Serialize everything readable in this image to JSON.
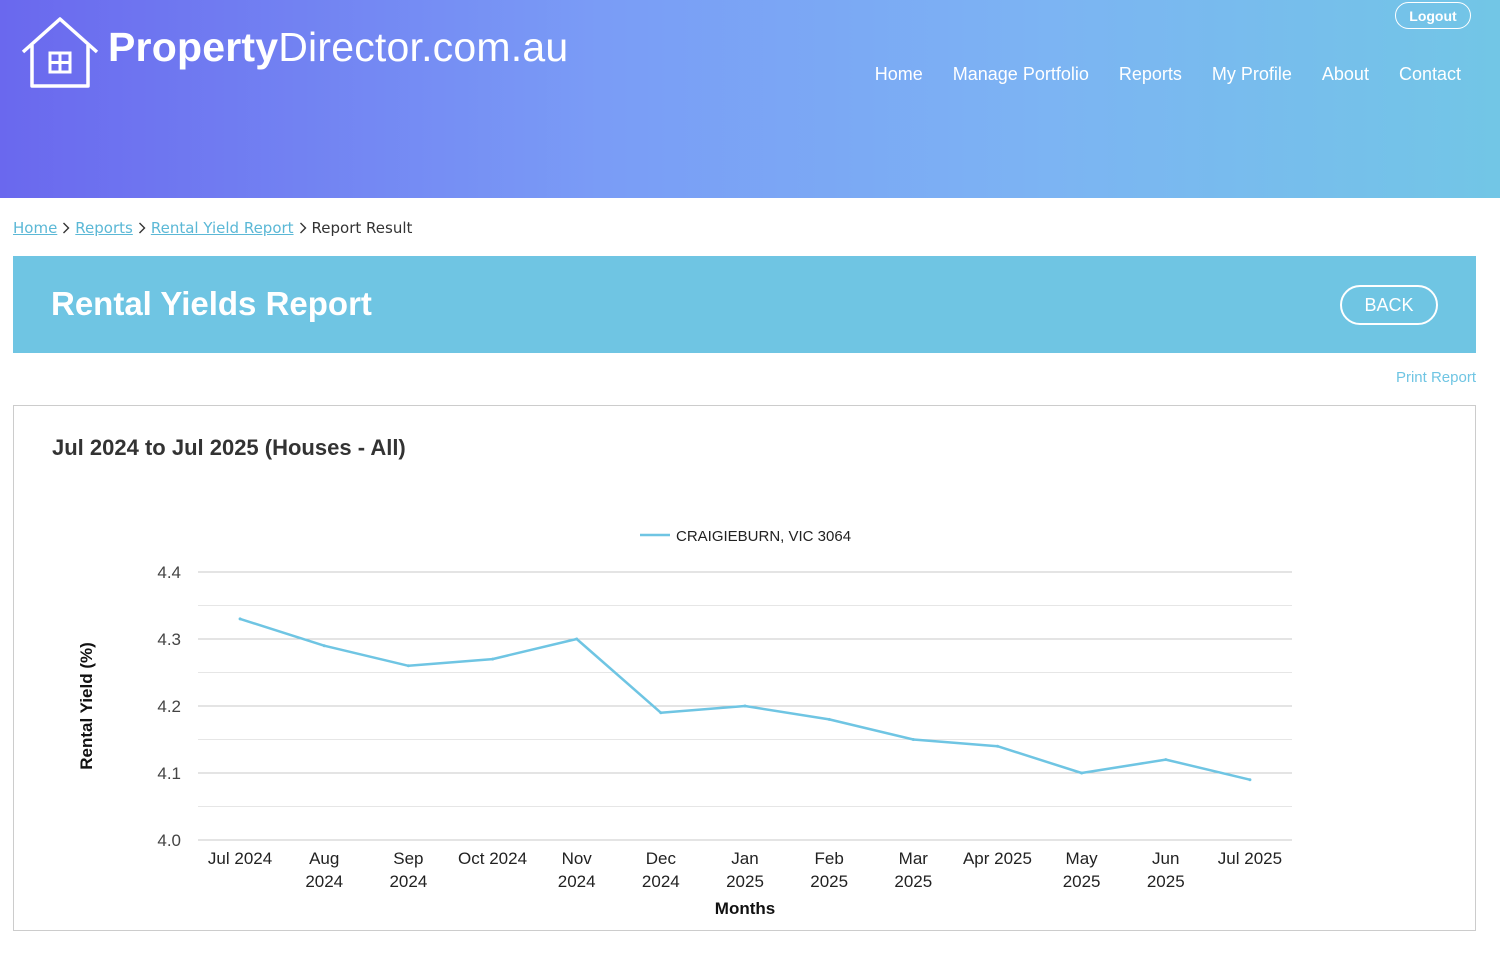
{
  "header": {
    "logo": {
      "bold": "Property",
      "rest": "Director.com.au"
    },
    "logout_label": "Logout",
    "nav": [
      "Home",
      "Manage Portfolio",
      "Reports",
      "My Profile",
      "About",
      "Contact"
    ]
  },
  "breadcrumb": {
    "items": [
      "Home",
      "Reports",
      "Rental Yield Report"
    ],
    "current": "Report Result"
  },
  "page": {
    "title": "Rental Yields Report",
    "back_label": "BACK",
    "print_label": "Print Report"
  },
  "colors": {
    "accent": "#6fc5e3",
    "series": "#6fc5e3"
  },
  "chart_data": {
    "type": "line",
    "title": "Jul 2024 to Jul 2025 (Houses - All)",
    "xlabel": "Months",
    "ylabel": "Rental Yield (%)",
    "ylim": [
      4.0,
      4.4
    ],
    "yticks": [
      4.0,
      4.1,
      4.2,
      4.3,
      4.4
    ],
    "grid": true,
    "legend_position": "top-center",
    "categories": [
      [
        "Jul 2024"
      ],
      [
        "Aug",
        "2024"
      ],
      [
        "Sep",
        "2024"
      ],
      [
        "Oct 2024"
      ],
      [
        "Nov",
        "2024"
      ],
      [
        "Dec",
        "2024"
      ],
      [
        "Jan",
        "2025"
      ],
      [
        "Feb",
        "2025"
      ],
      [
        "Mar",
        "2025"
      ],
      [
        "Apr 2025"
      ],
      [
        "May",
        "2025"
      ],
      [
        "Jun",
        "2025"
      ],
      [
        "Jul 2025"
      ]
    ],
    "series": [
      {
        "name": "CRAIGIEBURN, VIC 3064",
        "values": [
          4.33,
          4.29,
          4.26,
          4.27,
          4.3,
          4.19,
          4.2,
          4.18,
          4.15,
          4.14,
          4.1,
          4.12,
          4.09
        ]
      }
    ]
  }
}
